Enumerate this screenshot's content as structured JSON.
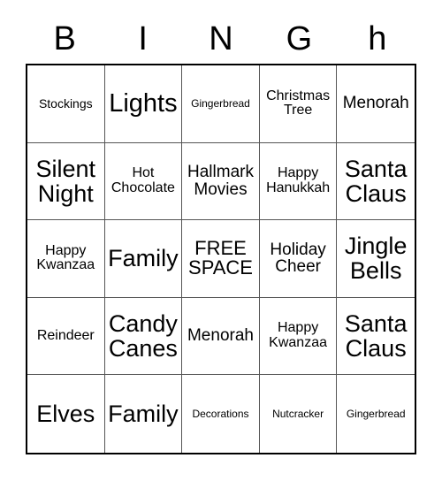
{
  "card": {
    "header_letters": [
      "B",
      "I",
      "N",
      "G",
      "h"
    ],
    "colors": {
      "background": "#ffffff",
      "text": "#000000",
      "grid_line": "#555555",
      "grid_outer_border": "#000000"
    },
    "grid": {
      "columns": 5,
      "rows": 5,
      "free_space_label": "FREE SPACE",
      "free_space_position": "row3-col3"
    },
    "rows": [
      [
        {
          "label": "Stockings",
          "size": "fs-sm"
        },
        {
          "label": "Lights",
          "size": "fs-huge"
        },
        {
          "label": "Gingerbread",
          "size": "fs-xs"
        },
        {
          "label": "Christmas Tree",
          "size": "fs-md"
        },
        {
          "label": "Menorah",
          "size": "fs-lg"
        }
      ],
      [
        {
          "label": "Silent Night",
          "size": "fs-xxl"
        },
        {
          "label": "Hot Chocolate",
          "size": "fs-md"
        },
        {
          "label": "Hallmark Movies",
          "size": "fs-lg"
        },
        {
          "label": "Happy Hanukkah",
          "size": "fs-md"
        },
        {
          "label": "Santa Claus",
          "size": "fs-xxl"
        }
      ],
      [
        {
          "label": "Happy Kwanzaa",
          "size": "fs-md"
        },
        {
          "label": "Family",
          "size": "fs-xxl"
        },
        {
          "label": "FREE SPACE",
          "size": "fs-xl"
        },
        {
          "label": "Holiday Cheer",
          "size": "fs-lg"
        },
        {
          "label": "Jingle Bells",
          "size": "fs-xxl"
        }
      ],
      [
        {
          "label": "Reindeer",
          "size": "fs-md"
        },
        {
          "label": "Candy Canes",
          "size": "fs-xxl"
        },
        {
          "label": "Menorah",
          "size": "fs-lg"
        },
        {
          "label": "Happy Kwanzaa",
          "size": "fs-md"
        },
        {
          "label": "Santa Claus",
          "size": "fs-xxl"
        }
      ],
      [
        {
          "label": "Elves",
          "size": "fs-xxl"
        },
        {
          "label": "Family",
          "size": "fs-xxl"
        },
        {
          "label": "Decorations",
          "size": "fs-xs"
        },
        {
          "label": "Nutcracker",
          "size": "fs-xs"
        },
        {
          "label": "Gingerbread",
          "size": "fs-xs"
        }
      ]
    ]
  }
}
